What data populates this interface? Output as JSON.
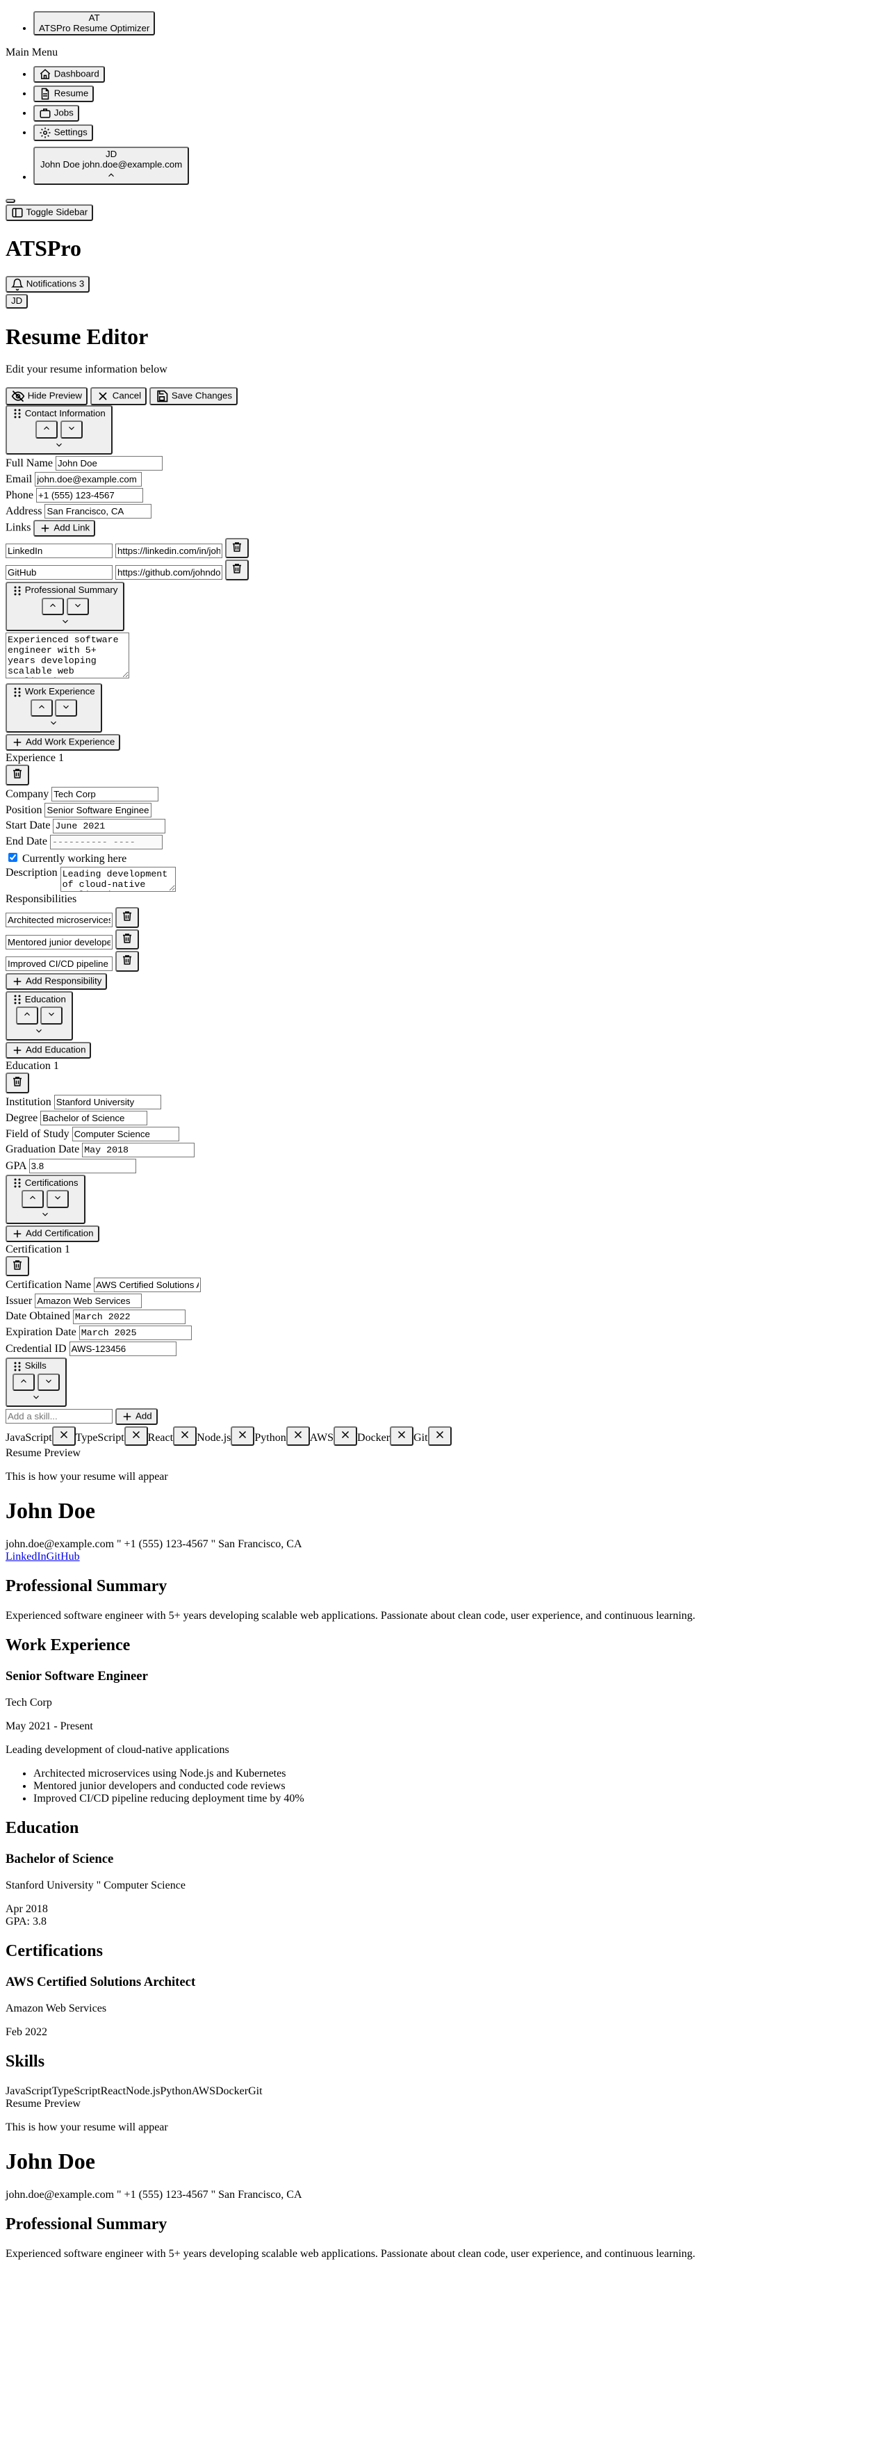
{
  "sidebar": {
    "logo_initials": "AT",
    "logo_text": "ATSPro Resume Optimizer",
    "menu_title": "Main Menu",
    "items": [
      {
        "label": "Dashboard",
        "icon": "home-icon"
      },
      {
        "label": "Resume",
        "icon": "file-icon"
      },
      {
        "label": "Jobs",
        "icon": "briefcase-icon"
      },
      {
        "label": "Settings",
        "icon": "gear-icon"
      }
    ],
    "user_initials": "JD",
    "user_text": "John Doe john.doe@example.com",
    "toggle_label": "Toggle Sidebar"
  },
  "header": {
    "app_title": "ATSPro",
    "notifications_label": "Notifications 3",
    "avatar_initials": "JD"
  },
  "editor": {
    "title": "Resume Editor",
    "subtitle": "Edit your resume information below",
    "hide_preview": "Hide Preview",
    "cancel": "Cancel",
    "save": "Save Changes"
  },
  "contact": {
    "section_label": "Contact Information",
    "full_name_label": "Full Name",
    "full_name": "John Doe",
    "email_label": "Email",
    "email": "john.doe@example.com",
    "phone_label": "Phone",
    "phone": "+1 (555) 123-4567",
    "address_label": "Address",
    "address": "San Francisco, CA",
    "links_label": "Links",
    "add_link": "Add Link",
    "links": [
      {
        "name": "LinkedIn",
        "url": "https://linkedin.com/in/johndoe"
      },
      {
        "name": "GitHub",
        "url": "https://github.com/johndoe"
      }
    ]
  },
  "summary": {
    "section_label": "Professional Summary",
    "text": "Experienced software engineer with 5+ years developing scalable web applications. Passionate about clean code, user experience, and continuous learning."
  },
  "work": {
    "section_label": "Work Experience",
    "add_label": "Add Work Experience",
    "item_title": "Experience 1",
    "company_label": "Company",
    "company": "Tech Corp",
    "position_label": "Position",
    "position": "Senior Software Engineer",
    "start_label": "Start Date",
    "start": "June 2021",
    "end_label": "End Date",
    "end_placeholder": "---------- ----",
    "current_label": "Currently working here",
    "description_label": "Description",
    "description": "Leading development of cloud-native applications",
    "responsibilities_label": "Responsibilities",
    "responsibilities": [
      "Architected microservices using Node.js and Kubernetes",
      "Mentored junior developers and conducted code reviews",
      "Improved CI/CD pipeline reducing deployment time by 40%"
    ],
    "add_responsibility": "Add Responsibility"
  },
  "education": {
    "section_label": "Education",
    "add_label": "Add Education",
    "item_title": "Education 1",
    "institution_label": "Institution",
    "institution": "Stanford University",
    "degree_label": "Degree",
    "degree": "Bachelor of Science",
    "field_label": "Field of Study",
    "field": "Computer Science",
    "grad_label": "Graduation Date",
    "grad": "May 2018",
    "gpa_label": "GPA",
    "gpa": "3.8"
  },
  "certifications": {
    "section_label": "Certifications",
    "add_label": "Add Certification",
    "item_title": "Certification 1",
    "name_label": "Certification Name",
    "name": "AWS Certified Solutions Architect",
    "issuer_label": "Issuer",
    "issuer": "Amazon Web Services",
    "obtained_label": "Date Obtained",
    "obtained": "March 2022",
    "expiration_label": "Expiration Date",
    "expiration": "March 2025",
    "credential_label": "Credential ID",
    "credential": "AWS-123456"
  },
  "skills": {
    "section_label": "Skills",
    "placeholder": "Add a skill...",
    "add_label": "Add",
    "items": [
      "JavaScript",
      "TypeScript",
      "React",
      "Node.js",
      "Python",
      "AWS",
      "Docker",
      "Git"
    ]
  },
  "preview": {
    "title": "Resume Preview",
    "subtitle": "This is how your resume will appear",
    "name": "John Doe",
    "contact_line": "john.doe@example.com \" +1 (555) 123-4567 \" San Francisco, CA",
    "link1": "LinkedIn",
    "link2": "GitHub",
    "summary_heading": "Professional Summary",
    "summary": "Experienced software engineer with 5+ years developing scalable web applications. Passionate about clean code, user experience, and continuous learning.",
    "work_heading": "Work Experience",
    "job_title": "Senior Software Engineer",
    "company": "Tech Corp",
    "dates": "May 2021 - Present",
    "description": "Leading development of cloud-native applications",
    "bullets": [
      "Architected microservices using Node.js and Kubernetes",
      "Mentored junior developers and conducted code reviews",
      "Improved CI/CD pipeline reducing deployment time by 40%"
    ],
    "education_heading": "Education",
    "degree": "Bachelor of Science",
    "school_line": "Stanford University \" Computer Science",
    "grad": "Apr 2018",
    "gpa": "GPA: 3.8",
    "cert_heading": "Certifications",
    "cert_name": "AWS Certified Solutions Architect",
    "cert_issuer": "Amazon Web Services",
    "cert_date": "Feb 2022",
    "skills_heading": "Skills",
    "skills_line": "JavaScriptTypeScriptReactNode.jsPythonAWSDockerGit"
  }
}
